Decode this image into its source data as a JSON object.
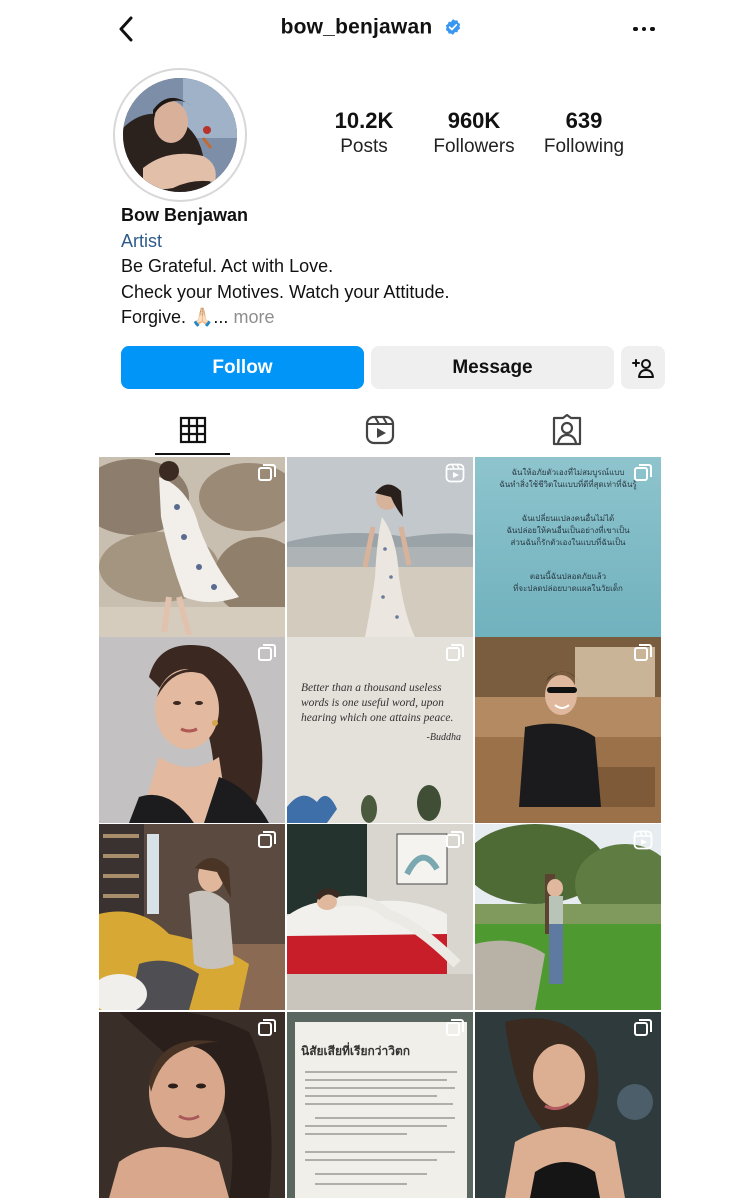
{
  "header": {
    "username": "bow_benjawan",
    "icons": {
      "back": "chevron-left-icon",
      "verified": "verified-badge-icon",
      "more": "more-horizontal-icon"
    }
  },
  "profile": {
    "stats": [
      {
        "value": "10.2K",
        "label": "Posts"
      },
      {
        "value": "960K",
        "label": "Followers"
      },
      {
        "value": "639",
        "label": "Following"
      }
    ],
    "display_name": "Bow Benjawan",
    "category": "Artist",
    "bio_lines": [
      "Be Grateful. Act with Love.",
      "Check your Motives. Watch your Attitude.",
      "Forgive. 🙏🏻..."
    ],
    "more_label": "more"
  },
  "actions": {
    "follow": "Follow",
    "message": "Message",
    "add_user_icon": "add-user-icon"
  },
  "tabs": [
    {
      "icon": "grid-icon",
      "active": true
    },
    {
      "icon": "reels-icon",
      "active": false
    },
    {
      "icon": "tagged-icon",
      "active": false
    }
  ],
  "posts": [
    {
      "badge": "carousel"
    },
    {
      "badge": "reel"
    },
    {
      "badge": "carousel",
      "text_lines": [
        "ฉันให้อภัยตัวเองที่ไม่สมบูรณ์แบบ",
        "ฉันทำสิ่งใช้ชีวิตในแบบที่ดีที่สุดเท่าที่ฉันรู้",
        "",
        "ฉันเปลี่ยนแปลงคนอื่นไม่ได้",
        "ฉันปล่อยให้คนอื่นเป็นอย่างที่เขาเป็น",
        "ส่วนฉันก็รักตัวเองในแบบที่ฉันเป็น",
        "",
        "ตอนนี้ฉันปลอดภัยแล้ว",
        "ที่จะปลดปล่อยบาดแผลในวัยเด็ก"
      ]
    },
    {
      "badge": "carousel"
    },
    {
      "badge": "carousel",
      "quote": "Better than a thousand useless words is one useful word, upon hearing which one attains peace.",
      "quote_author": "-Buddha"
    },
    {
      "badge": "carousel"
    },
    {
      "badge": "carousel"
    },
    {
      "badge": "carousel"
    },
    {
      "badge": "reel"
    },
    {
      "badge": "carousel"
    },
    {
      "badge": "carousel",
      "book_title": "นิสัยเสียที่เรียกว่าวิตก"
    },
    {
      "badge": "carousel"
    }
  ],
  "colors": {
    "accent": "#0095f6",
    "category": "#2e5a8a",
    "button_gray": "#efefef"
  }
}
